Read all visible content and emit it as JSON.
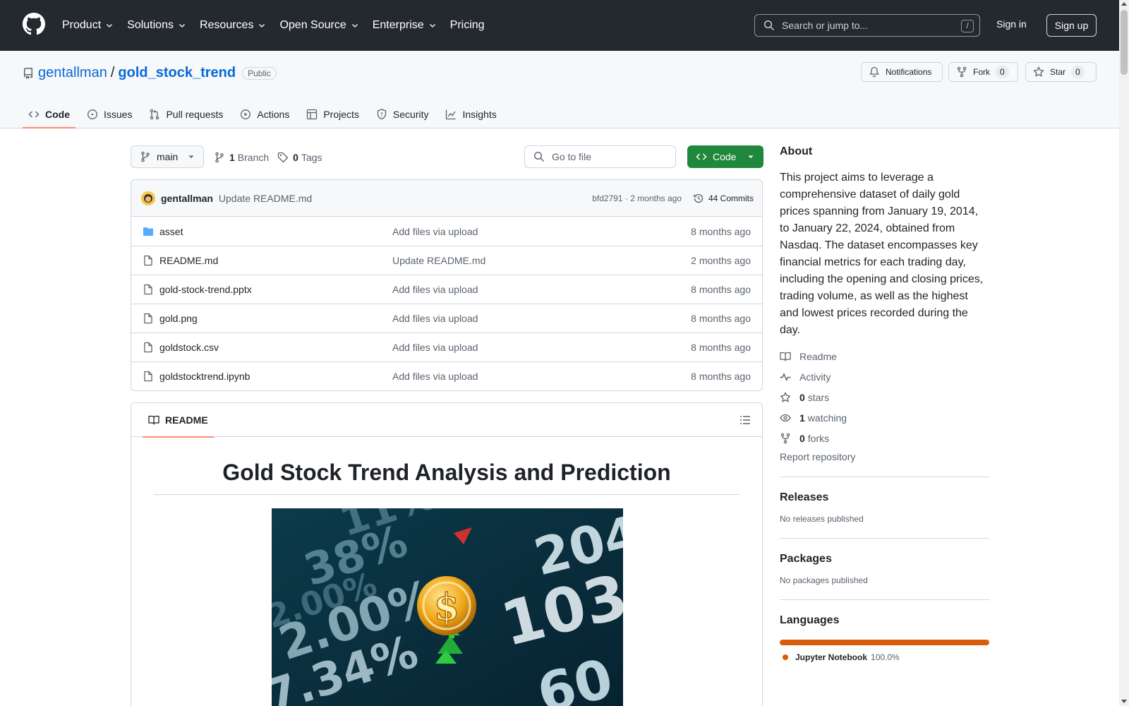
{
  "header": {
    "nav": [
      "Product",
      "Solutions",
      "Resources",
      "Open Source",
      "Enterprise",
      "Pricing"
    ],
    "search_placeholder": "Search or jump to...",
    "search_shortcut": "/",
    "sign_in": "Sign in",
    "sign_up": "Sign up"
  },
  "repo": {
    "owner": "gentallman",
    "separator": "/",
    "name": "gold_stock_trend",
    "visibility": "Public",
    "notifications_label": "Notifications",
    "fork_label": "Fork",
    "fork_count": "0",
    "star_label": "Star",
    "star_count": "0"
  },
  "tabs": [
    "Code",
    "Issues",
    "Pull requests",
    "Actions",
    "Projects",
    "Security",
    "Insights"
  ],
  "toolbar": {
    "branch": "main",
    "branch_count": "1",
    "branch_label": "Branch",
    "tag_count": "0",
    "tag_label": "Tags",
    "goto_placeholder": "Go to file",
    "code_button": "Code"
  },
  "commit": {
    "author": "gentallman",
    "message": "Update README.md",
    "sha_time": "bfd2791 · 2 months ago",
    "commits": "44 Commits"
  },
  "files": [
    {
      "name": "asset",
      "type": "folder",
      "message": "Add files via upload",
      "date": "8 months ago"
    },
    {
      "name": "README.md",
      "type": "file",
      "message": "Update README.md",
      "date": "2 months ago"
    },
    {
      "name": "gold-stock-trend.pptx",
      "type": "file",
      "message": "Add files via upload",
      "date": "8 months ago"
    },
    {
      "name": "gold.png",
      "type": "file",
      "message": "Add files via upload",
      "date": "8 months ago"
    },
    {
      "name": "goldstock.csv",
      "type": "file",
      "message": "Add files via upload",
      "date": "8 months ago"
    },
    {
      "name": "goldstocktrend.ipynb",
      "type": "file",
      "message": "Add files via upload",
      "date": "8 months ago"
    }
  ],
  "readme": {
    "tab_label": "README",
    "title": "Gold Stock Trend Analysis and Prediction",
    "image_text": [
      "11%",
      "38%",
      "2.00%",
      "2.00%",
      "7.34%",
      "204",
      "103",
      "60"
    ]
  },
  "about": {
    "heading": "About",
    "description": "This project aims to leverage a comprehensive dataset of daily gold prices spanning from January 19, 2014, to January 22, 2024, obtained from Nasdaq. The dataset encompasses key financial metrics for each trading day, including the opening and closing prices, trading volume, as well as the highest and lowest prices recorded during the day.",
    "readme": "Readme",
    "activity": "Activity",
    "stars_count": "0",
    "stars_label": "stars",
    "watching_count": "1",
    "watching_label": "watching",
    "forks_count": "0",
    "forks_label": "forks",
    "report": "Report repository"
  },
  "releases": {
    "heading": "Releases",
    "text": "No releases published"
  },
  "packages": {
    "heading": "Packages",
    "text": "No packages published"
  },
  "languages": {
    "heading": "Languages",
    "name": "Jupyter Notebook",
    "percent": "100.0%",
    "share": 1.0,
    "color": "#da5b0b"
  },
  "colors": {
    "header_bg": "#24292f",
    "link": "#0969da",
    "primary_btn": "#1f883d",
    "tab_underline": "#fd8c73"
  }
}
